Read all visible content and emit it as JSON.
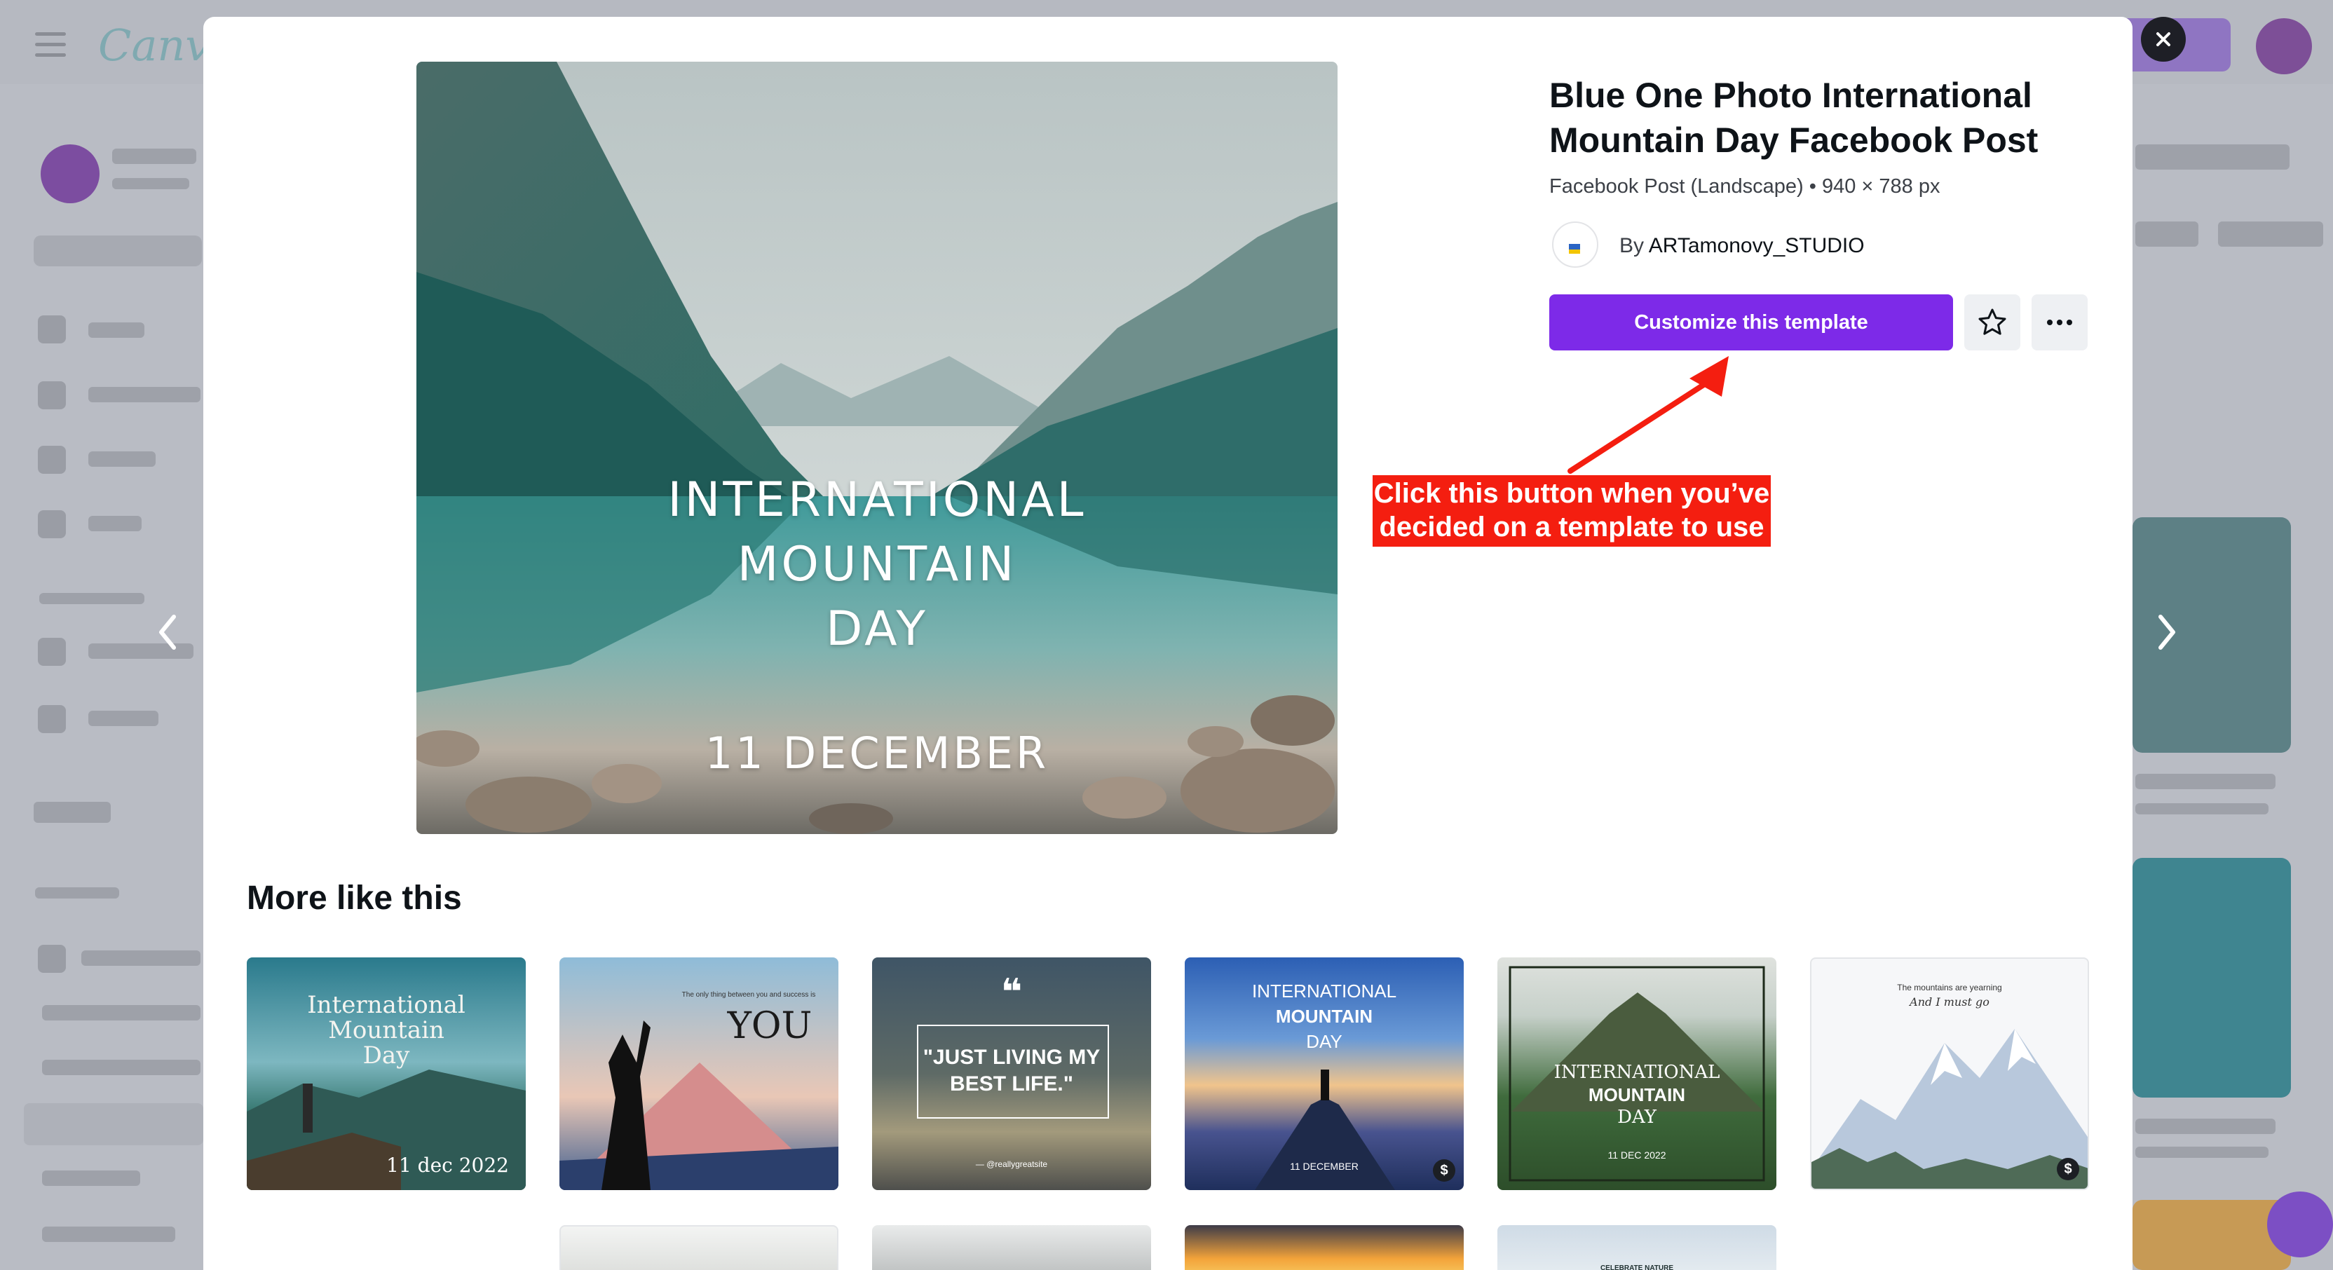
{
  "background_app": {
    "logo": "Canva"
  },
  "template": {
    "title": "Blue One Photo International Mountain Day Facebook Post",
    "subtitle": "Facebook Post (Landscape) • 940 × 788 px",
    "author_prefix": "By",
    "author_name": "ARTamonovy_STUDIO",
    "customize_label": "Customize this template",
    "preview_lines": [
      "INTERNATIONAL",
      "MOUNTAIN",
      "DAY"
    ],
    "preview_date": "11 DECEMBER"
  },
  "annotation": {
    "line1": "Click this button when you’ve",
    "line2": "decided on a template to use",
    "color": "#f41e10"
  },
  "more_like_this": {
    "heading": "More like this",
    "cards": [
      {
        "line1": "International",
        "line2": "Mountain",
        "line3": "Day",
        "date": "11 dec 2022"
      },
      {
        "small": "The only thing between you and success is",
        "big": "YOU"
      },
      {
        "quote_mark": "❝",
        "line1": "\"JUST LIVING MY",
        "line2": "BEST LIFE.\"",
        "site": "— @reallygreatsite"
      },
      {
        "line1": "INTERNATIONAL",
        "line2": "MOUNTAIN",
        "line3": "DAY",
        "date": "11 DECEMBER",
        "badge": "$"
      },
      {
        "line1": "INTERNATIONAL",
        "line2": "MOUNTAIN",
        "line3": "DAY",
        "date": "11 DEC 2022"
      },
      {
        "line1": "The mountains are yearning",
        "line2": "And I must go",
        "badge": "$"
      }
    ],
    "row2_cards": [
      {
        "label": ""
      },
      {
        "label": ""
      },
      {
        "label": ""
      },
      {
        "label": "CELEBRATE NATURE"
      }
    ]
  },
  "colors": {
    "accent": "#7d2ae8",
    "overlay": "#b9bcc4"
  },
  "icons": {
    "close": "close-icon",
    "prev": "chevron-left-icon",
    "next": "chevron-right-icon",
    "star": "star-icon",
    "more": "more-horizontal-icon"
  }
}
